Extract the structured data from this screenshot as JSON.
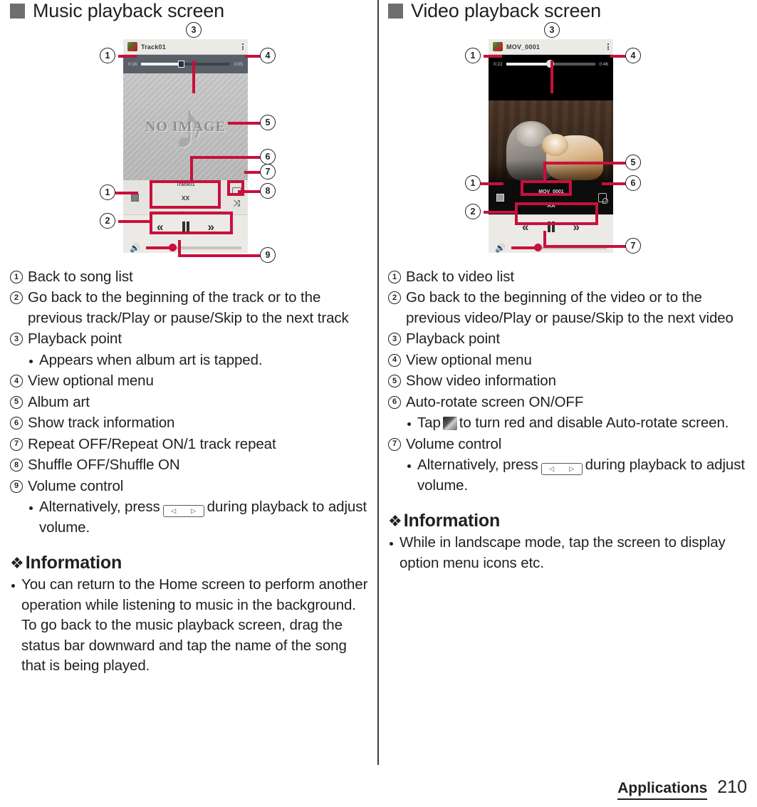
{
  "footer": {
    "section": "Applications",
    "page": "210"
  },
  "left": {
    "heading": "Music playback screen",
    "phone": {
      "app_title": "Track01",
      "time_elapsed": "0:16",
      "time_total": "3:05",
      "art_label": "NO IMAGE",
      "meta_title": "Track01",
      "meta_artist": "XX",
      "meta_album": "Music",
      "menu_icon": "overflow-menu-icon",
      "list_icon": "song-list-icon",
      "repeat_icon": "repeat-icon",
      "shuffle_icon": "shuffle-icon",
      "prev_icon": "previous-track-icon",
      "pause_icon": "pause-icon",
      "next_icon": "next-track-icon",
      "volume_icon": "speaker-icon",
      "nav_back_icon": "back-icon",
      "nav_home_icon": "home-icon",
      "nav_recents_icon": "recents-icon"
    },
    "callouts": [
      "1",
      "2",
      "3",
      "4",
      "5",
      "6",
      "7",
      "8",
      "9"
    ],
    "items": [
      {
        "num": "1",
        "text": "Back to song list"
      },
      {
        "num": "2",
        "text": "Go back to the beginning of the track or to the previous track/Play or pause/Skip to the next track"
      },
      {
        "num": "3",
        "text": "Playback point",
        "sub": [
          "Appears when album art is tapped."
        ]
      },
      {
        "num": "4",
        "text": "View optional menu"
      },
      {
        "num": "5",
        "text": "Album art"
      },
      {
        "num": "6",
        "text": "Show track information"
      },
      {
        "num": "7",
        "text": "Repeat OFF/Repeat ON/1 track repeat"
      },
      {
        "num": "8",
        "text": "Shuffle OFF/Shuffle ON"
      },
      {
        "num": "9",
        "text": "Volume control"
      }
    ],
    "volume_note_pre": "Alternatively, press",
    "volume_note_post": "during playback to adjust volume.",
    "information": {
      "heading": "Information",
      "bullets": [
        "You can return to the Home screen to perform another operation while listening to music in the background. To go back to the music playback screen, drag the status bar downward and tap the name of the song that is being played."
      ]
    }
  },
  "right": {
    "heading": "Video playback screen",
    "phone": {
      "app_title": "MOV_0001",
      "time_elapsed": "0:22",
      "time_total": "0:46",
      "meta_title": "MOV_0001",
      "meta_sub": "XX",
      "menu_icon": "overflow-menu-icon",
      "list_icon": "video-list-icon",
      "rotate_icon": "auto-rotate-icon",
      "prev_icon": "previous-video-icon",
      "pause_icon": "pause-icon",
      "next_icon": "next-video-icon",
      "volume_icon": "speaker-icon",
      "nav_back_icon": "back-icon",
      "nav_home_icon": "home-icon",
      "nav_recents_icon": "recents-icon"
    },
    "callouts": [
      "1",
      "2",
      "3",
      "4",
      "5",
      "6",
      "7"
    ],
    "items": [
      {
        "num": "1",
        "text": "Back to video list"
      },
      {
        "num": "2",
        "text": "Go back to the beginning of the video or to the previous video/Play or pause/Skip to the next video"
      },
      {
        "num": "3",
        "text": "Playback point"
      },
      {
        "num": "4",
        "text": "View optional menu"
      },
      {
        "num": "5",
        "text": "Show video information"
      },
      {
        "num": "6",
        "text": "Auto-rotate screen ON/OFF"
      },
      {
        "num": "7",
        "text": "Volume control"
      }
    ],
    "rotate_note_pre": "Tap",
    "rotate_note_post": "to turn red and disable Auto-rotate screen.",
    "volume_note_pre": "Alternatively, press",
    "volume_note_post": "during playback to adjust volume.",
    "information": {
      "heading": "Information",
      "bullets": [
        "While in landscape mode, tap the screen to display option menu icons etc."
      ]
    }
  }
}
